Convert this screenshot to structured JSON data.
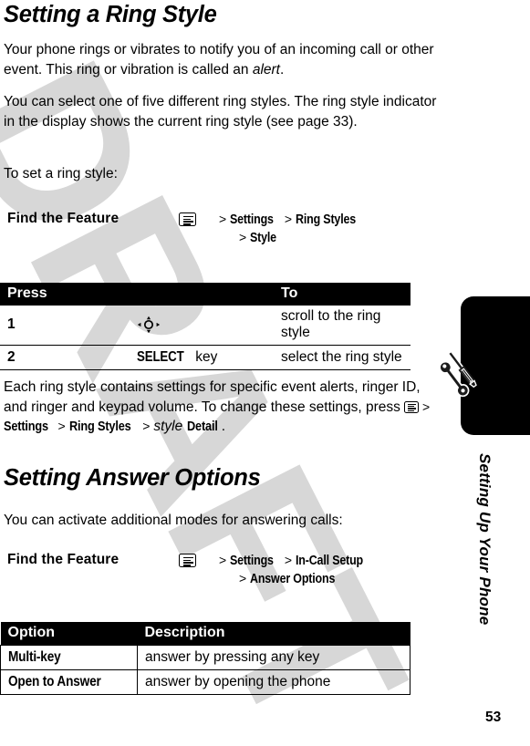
{
  "page": {
    "number": "53",
    "watermark": "DRAFT",
    "chapter_tab_title": "Setting Up Your Phone",
    "chapter_tab_icon": "wrench-screwdriver-icon"
  },
  "sections": [
    {
      "heading": "Setting a Ring Style",
      "paragraphs": [
        {
          "id": "p1",
          "runs": [
            {
              "text": "Your phone rings or vibrates to notify you of an incoming call or other event. This ring or vibration is called an ",
              "style": "normal"
            },
            {
              "text": "alert",
              "style": "italic"
            },
            {
              "text": ".",
              "style": "normal"
            }
          ]
        },
        {
          "id": "p2",
          "runs": [
            {
              "text": "You can select one of five different ring styles. The ring style indicator in the display shows the current ring style (see page 33).",
              "style": "normal"
            }
          ]
        },
        {
          "id": "p3",
          "runs": [
            {
              "text": "To set a ring style:",
              "style": "normal"
            }
          ]
        }
      ],
      "find_the_feature": {
        "label": "Find the Feature",
        "icon": "menu-key-icon",
        "path_line_1": "Settings",
        "path_line_1b": "Ring Styles",
        "path_line_2": "Style",
        "separator": ">"
      },
      "press_table": {
        "headers": [
          "Press",
          "To"
        ],
        "rows": [
          {
            "num": "1",
            "key": "",
            "key_icon": "four-way-nav-key-icon",
            "key_suffix": "",
            "to": "scroll to the ring style"
          },
          {
            "num": "2",
            "key": "SELECT",
            "key_icon": "",
            "key_suffix": "key",
            "to": "select the ring style"
          }
        ]
      },
      "closing_paragraph": {
        "runs": [
          {
            "text": "Each ring style contains settings for specific event alerts, ringer ID, and ringer and keypad volume. To change these settings, press ",
            "style": "normal"
          },
          {
            "text": "menu-key-icon",
            "style": "icon"
          },
          {
            "text": " > ",
            "style": "normal"
          },
          {
            "text": "Settings",
            "style": "menuitem"
          },
          {
            "text": " > ",
            "style": "normal"
          },
          {
            "text": "Ring Styles",
            "style": "menuitem"
          },
          {
            "text": " > ",
            "style": "normal"
          },
          {
            "text": "style",
            "style": "italic"
          },
          {
            "text": " Detail",
            "style": "menuitem"
          },
          {
            "text": ".",
            "style": "normal"
          }
        ],
        "menu_1": "Settings",
        "menu_2": "Ring Styles",
        "variable": "style",
        "menu_3": "Detail"
      }
    },
    {
      "heading": "Setting Answer Options",
      "paragraphs": [
        {
          "id": "p1",
          "runs": [
            {
              "text": "You can activate additional modes for answering calls:",
              "style": "normal"
            }
          ]
        }
      ],
      "find_the_feature": {
        "label": "Find the Feature",
        "icon": "menu-key-icon",
        "path_line_1": "Settings",
        "path_line_1b": "In-Call Setup",
        "path_line_2": "Answer Options",
        "separator": ">"
      },
      "option_table": {
        "headers": [
          "Option",
          "Description"
        ],
        "rows": [
          {
            "option": "Multi-key",
            "description": "answer by pressing any key"
          },
          {
            "option": "Open to Answer",
            "description": "answer by opening the phone"
          }
        ]
      }
    }
  ],
  "colors": {
    "text": "#000000",
    "header_band": "#000000",
    "header_text": "#ffffff",
    "watermark": "#d7d7d7",
    "page_background": "#ffffff"
  }
}
